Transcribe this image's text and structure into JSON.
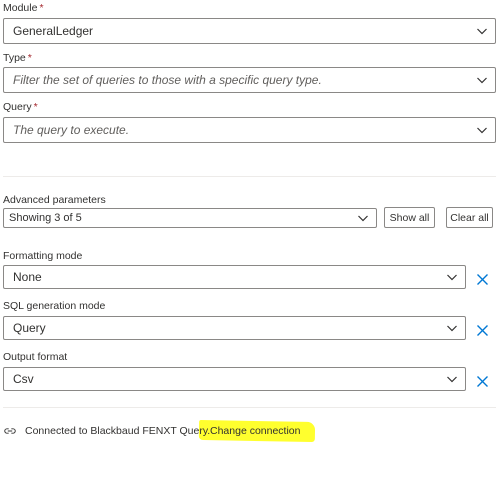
{
  "module": {
    "label": "Module",
    "required": "*",
    "value": "GeneralLedger"
  },
  "type": {
    "label": "Type",
    "required": "*",
    "placeholder": "Filter the set of queries to those with a specific query type."
  },
  "query": {
    "label": "Query",
    "required": "*",
    "placeholder": "The query to execute."
  },
  "advanced": {
    "label": "Advanced parameters",
    "value": "Showing 3 of 5",
    "show_all": "Show all",
    "clear_all": "Clear all"
  },
  "formatting": {
    "label": "Formatting mode",
    "value": "None"
  },
  "sqlgen": {
    "label": "SQL generation mode",
    "value": "Query"
  },
  "output": {
    "label": "Output format",
    "value": "Csv"
  },
  "status": {
    "text": "Connected to Blackbaud FENXT Query.",
    "change_link": "Change connection"
  },
  "colors": {
    "remove_icon": "#0078d4",
    "highlight": "#ffff2e",
    "required": "#a4262c"
  },
  "icons": {
    "chevron": "chevron-down-icon",
    "remove": "close-icon",
    "connection": "link-icon"
  }
}
